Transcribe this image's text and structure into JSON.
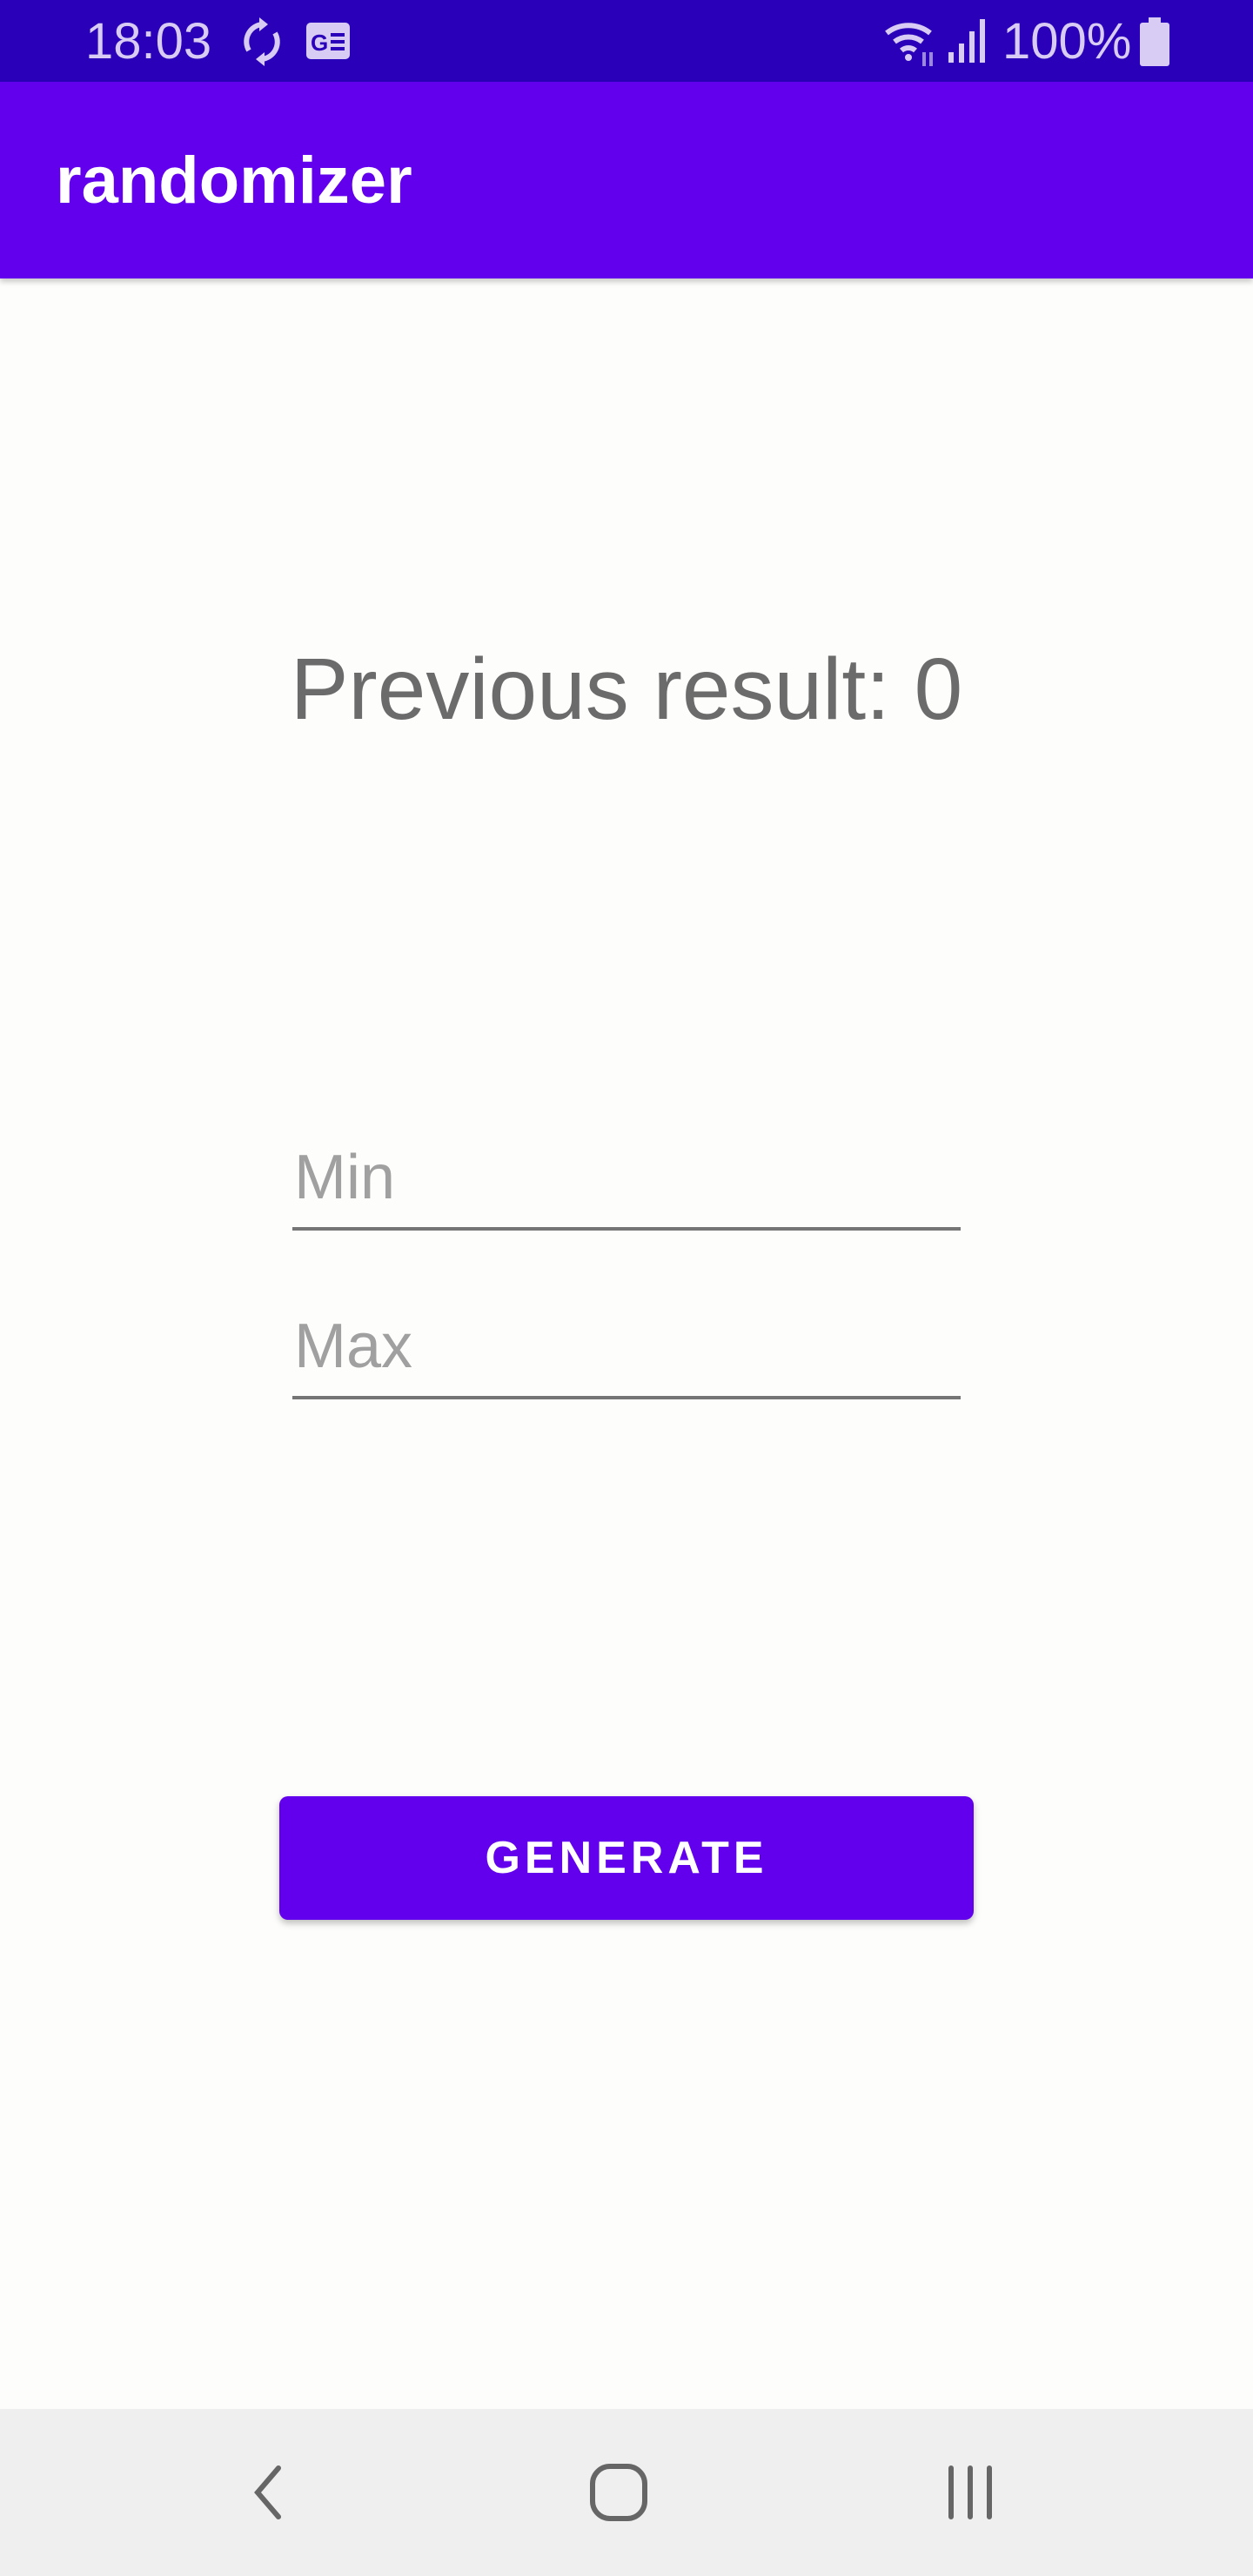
{
  "status_bar": {
    "time": "18:03",
    "battery": "100%",
    "icons": [
      "sync-icon",
      "news-icon",
      "wifi-icon",
      "signal-icon",
      "battery-icon"
    ]
  },
  "app_bar": {
    "title": "randomizer",
    "color": "#6200EE"
  },
  "main": {
    "previous_result": "Previous result: 0",
    "min_field": {
      "value": "",
      "placeholder": "Min"
    },
    "max_field": {
      "value": "",
      "placeholder": "Max"
    },
    "generate_label": "GENERATE"
  },
  "nav_bar": {
    "icons": [
      "back-icon",
      "home-icon",
      "recents-icon"
    ]
  }
}
